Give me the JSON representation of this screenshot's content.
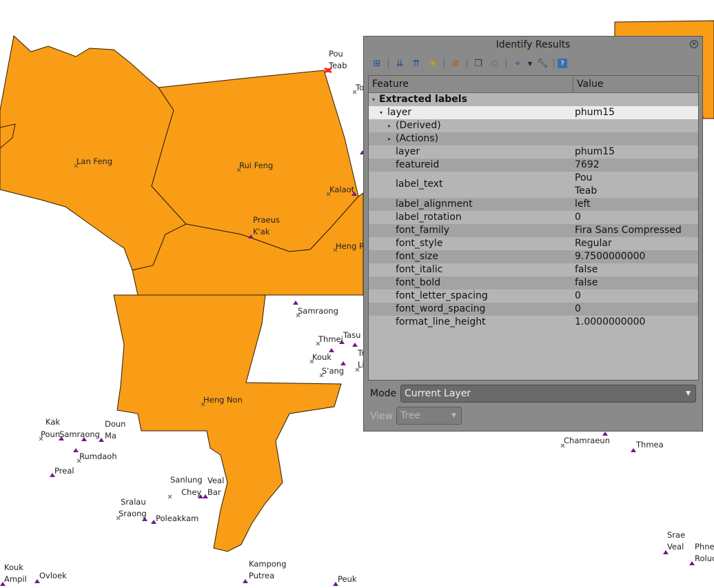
{
  "map": {
    "labels": [
      "Pou",
      "Teab",
      "To",
      "Lan Feng",
      "Rui Feng",
      "Kalaot",
      "Praeus",
      "K'ak",
      "Heng Ru",
      "Samraong",
      "Thmei",
      "Tasu",
      "Tr",
      "Kouk",
      "Li",
      "S'ang",
      "Heng Non",
      "Kak",
      "Poun",
      "Samraong",
      "Doun",
      "Ma",
      "Rumdaoh",
      "Preal",
      "Sanlung",
      "Chey",
      "Veal",
      "Bar",
      "Sralau",
      "Sraong",
      "Poleakkam",
      "Kampong",
      "Putrea",
      "Peuk",
      "Kouk",
      "Ampil",
      "Ovloek",
      "Chamraeun",
      "Thmea",
      "Srae",
      "Veal",
      "Phnea",
      "Roluo"
    ]
  },
  "panel": {
    "title": "Identify Results",
    "columns": {
      "feature": "Feature",
      "value": "Value"
    },
    "group": "Extracted labels",
    "layer_row": {
      "feature": "layer",
      "value": "phum15"
    },
    "derived": "(Derived)",
    "actions": "(Actions)",
    "attributes": [
      {
        "name": "layer",
        "value": "phum15"
      },
      {
        "name": "featureid",
        "value": "7692"
      },
      {
        "name": "label_text",
        "value_line1": "Pou",
        "value_line2": "Teab"
      },
      {
        "name": "label_alignment",
        "value": "left"
      },
      {
        "name": "label_rotation",
        "value": "0"
      },
      {
        "name": "font_family",
        "value": "Fira Sans Compressed"
      },
      {
        "name": "font_style",
        "value": "Regular"
      },
      {
        "name": "font_size",
        "value": "9.7500000000"
      },
      {
        "name": "font_italic",
        "value": "false"
      },
      {
        "name": "font_bold",
        "value": "false"
      },
      {
        "name": "font_letter_spacing",
        "value": "0"
      },
      {
        "name": "font_word_spacing",
        "value": "0"
      },
      {
        "name": "format_line_height",
        "value": "1.0000000000"
      }
    ],
    "mode_label": "Mode",
    "mode_value": "Current Layer",
    "view_label": "View",
    "view_value": "Tree"
  },
  "colors": {
    "polygon_fill": "#f99d16",
    "panel_bg": "#8a8a8a",
    "marker": "#6e1a8c",
    "highlight": "#ff2020"
  }
}
